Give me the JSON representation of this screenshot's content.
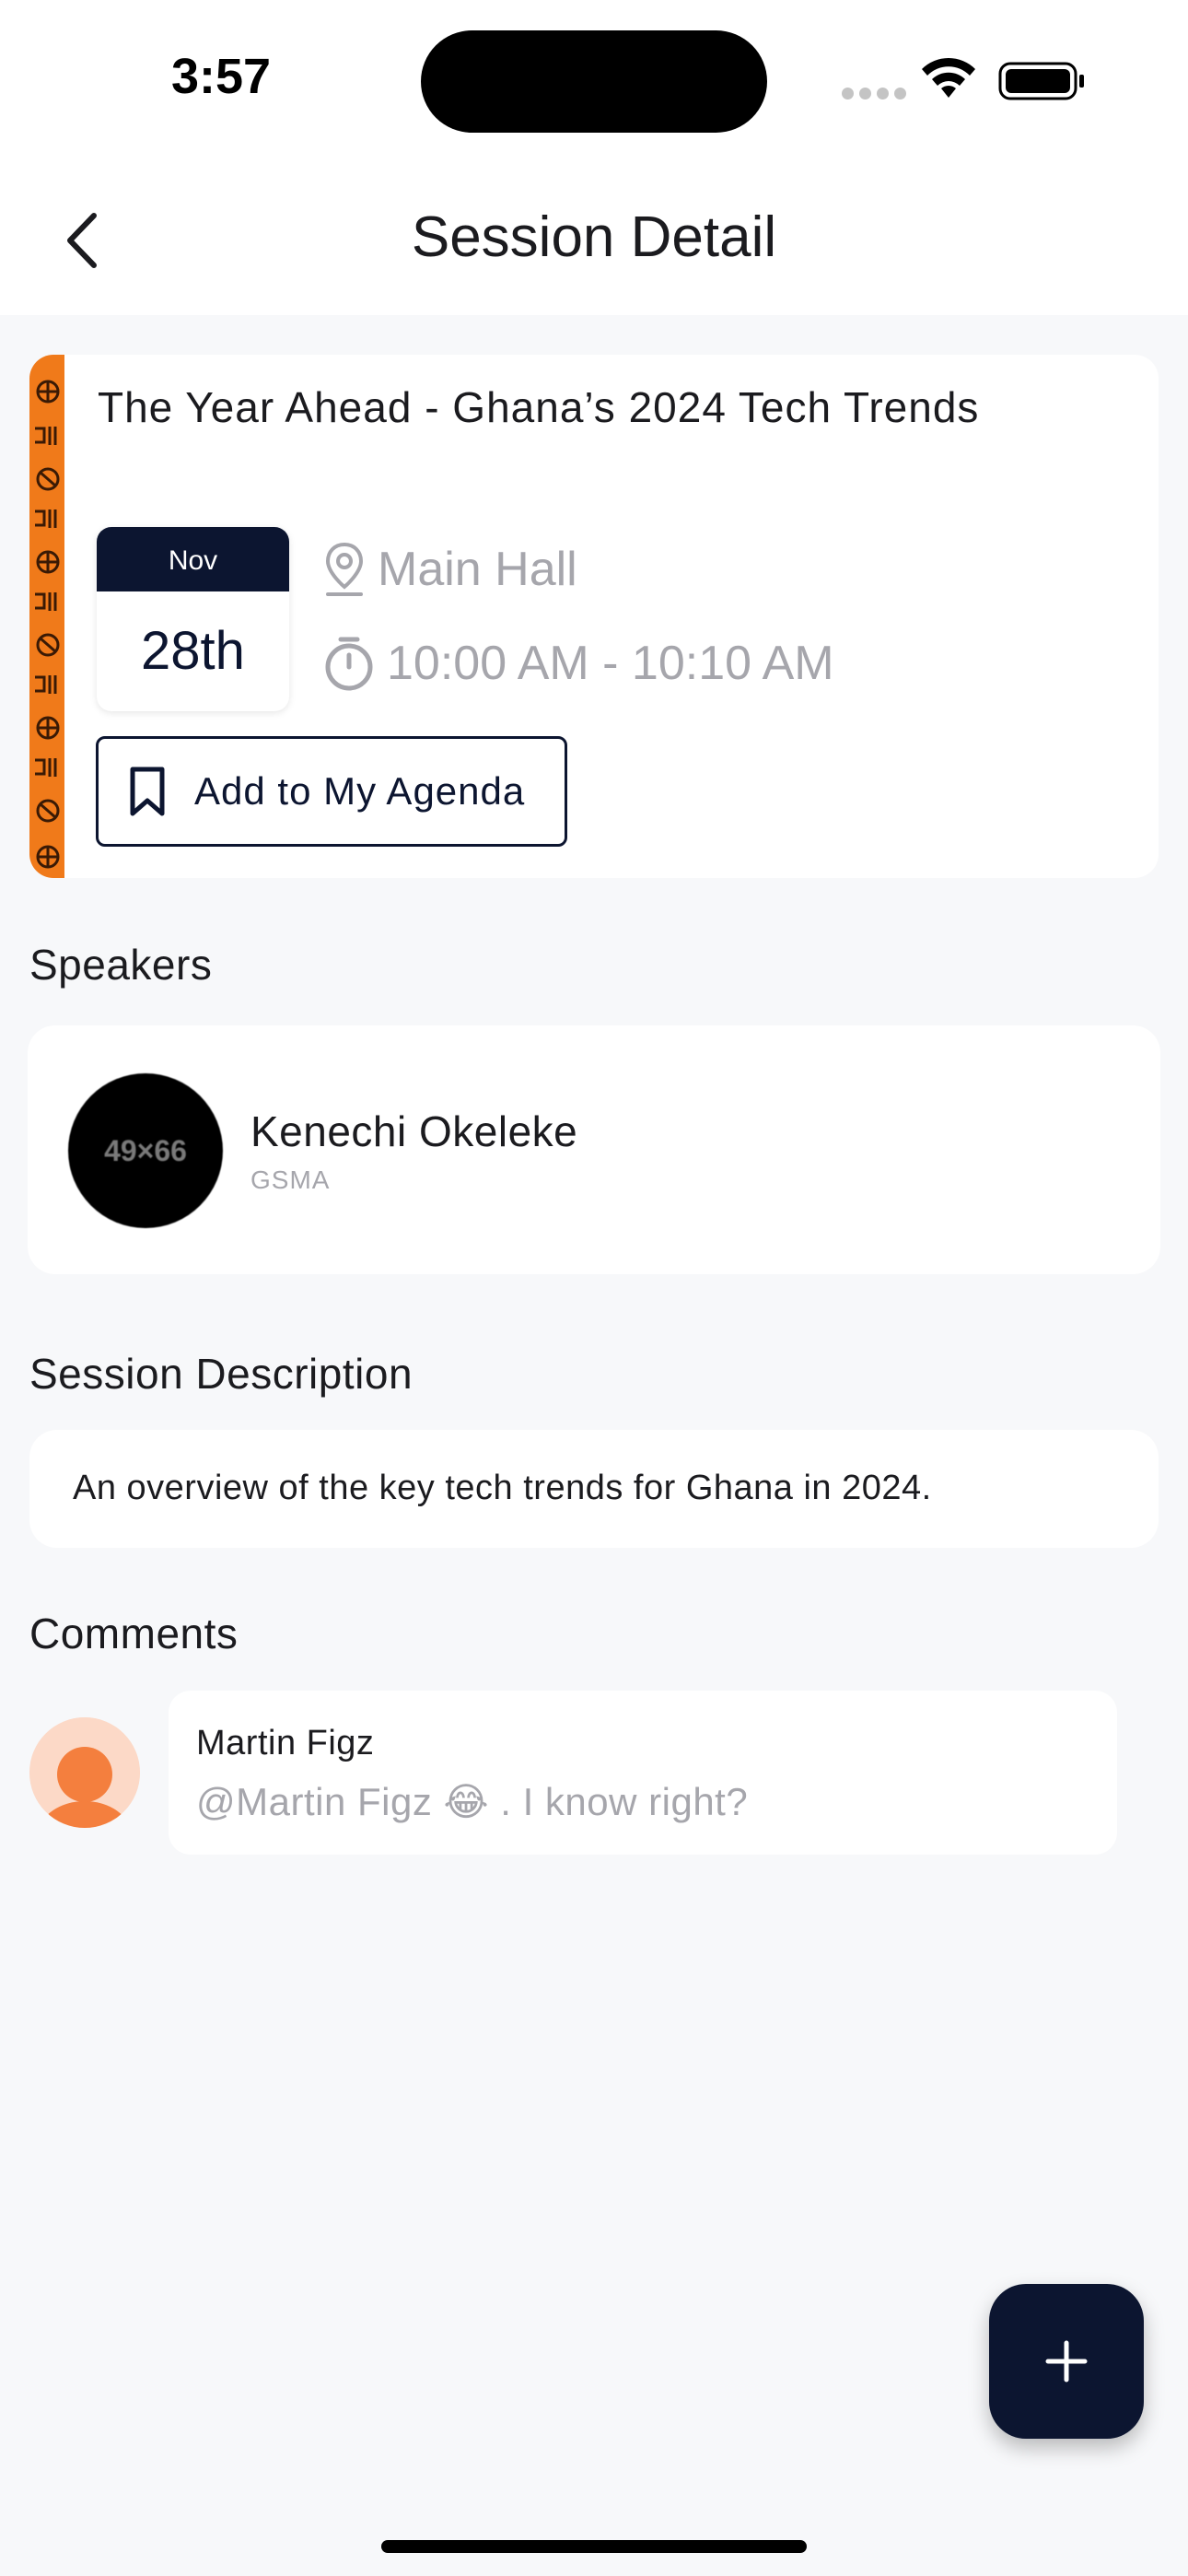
{
  "status_bar": {
    "time": "3:57"
  },
  "nav": {
    "title": "Session Detail"
  },
  "session": {
    "title": "The Year Ahead - Ghana’s 2024 Tech Trends",
    "date_month": "Nov",
    "date_day": "28th",
    "location": "Main Hall",
    "time_range": "10:00 AM - 10:10 AM",
    "agenda_button": "Add to My Agenda"
  },
  "speakers": {
    "label": "Speakers",
    "items": [
      {
        "name": "Kenechi Okeleke",
        "organization": "GSMA",
        "avatar_text": "49×66"
      }
    ]
  },
  "description": {
    "label": "Session Description",
    "text": "An overview of the key tech trends for Ghana in 2024."
  },
  "comments": {
    "label": "Comments",
    "items": [
      {
        "author": "Martin Figz",
        "text": "@Martin Figz 😂 . I know right?"
      }
    ]
  },
  "colors": {
    "primary": "#0c1530",
    "accent_pattern": "#f07a1a",
    "background": "#f7f8fa",
    "muted_text": "#a6a6ac"
  },
  "icons": [
    "chevron-left-icon",
    "location-pin-icon",
    "stopwatch-icon",
    "bookmark-icon",
    "plus-icon",
    "user-avatar-icon",
    "wifi-icon",
    "battery-icon"
  ]
}
